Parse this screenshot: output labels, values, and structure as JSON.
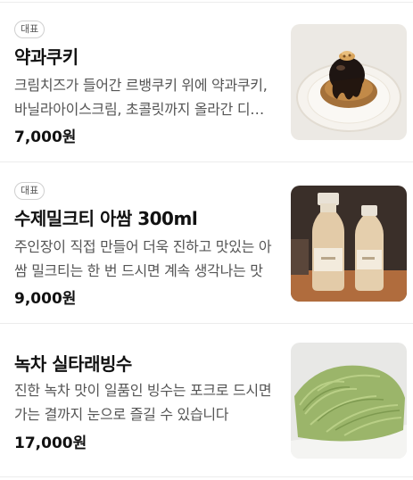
{
  "menu": {
    "items": [
      {
        "badge": "대표",
        "name": "약과쿠키",
        "description": "크림치즈가 들어간 르뱅쿠키 위에 약과쿠키, 바닐라아이스크림, 초콜릿까지 올라간 디저트",
        "price": "7,000원",
        "image": "yakgwa-cookie-photo"
      },
      {
        "badge": "대표",
        "name": "수제밀크티 아쌈 300ml",
        "description": "주인장이 직접 만들어 더욱 진하고 맛있는 아쌈 밀크티는 한 번 드시면 계속 생각나는 맛",
        "price": "9,000원",
        "image": "milk-tea-bottles-photo"
      },
      {
        "badge": "",
        "name": "녹차 실타래빙수",
        "description": "진한 녹차 맛이 일품인 빙수는 포크로 드시면 가는 결까지 눈으로 즐길 수 있습니다",
        "price": "17,000원",
        "image": "green-tea-bingsu-photo"
      }
    ]
  }
}
